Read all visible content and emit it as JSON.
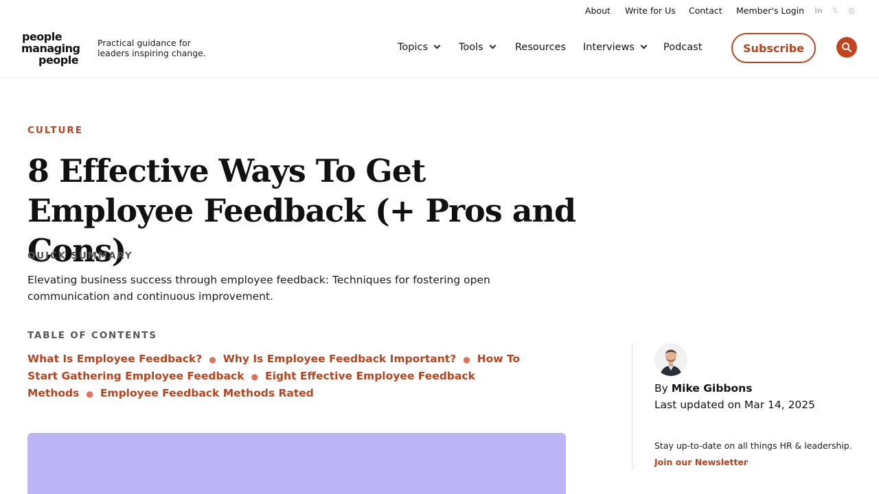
{
  "utility_nav": {
    "about": "About",
    "write_for_us": "Write for Us",
    "contact": "Contact",
    "members_login": "Member's Login"
  },
  "social": {
    "linkedin_icon": "in",
    "x_icon": "𝕏",
    "instagram_icon": "◎"
  },
  "logo": {
    "line1": "people",
    "line2": "managing",
    "line3": "people"
  },
  "tagline": "Practical guidance for leaders inspiring change.",
  "main_nav": {
    "topics": "Topics",
    "tools": "Tools",
    "resources": "Resources",
    "interviews": "Interviews",
    "podcast": "Podcast",
    "subscribe": "Subscribe"
  },
  "article": {
    "category": "CULTURE",
    "title": "8 Effective Ways To Get Employee Feedback (+ Pros and Cons)",
    "summary_label": "QUICK SUMMARY",
    "summary": "Elevating business success through employee feedback: Techniques for fostering open communication and continuous improvement.",
    "toc_label": "TABLE OF CONTENTS",
    "toc": [
      "What Is Employee Feedback?",
      "Why Is Employee Feedback Important?",
      "How To Start Gathering Employee Feedback",
      "Eight Effective Employee Feedback Methods",
      "Employee Feedback Methods Rated"
    ]
  },
  "sidebar": {
    "by_prefix": "By",
    "author": "Mike Gibbons",
    "updated": "Last updated on Mar 14, 2025",
    "newsletter_text": "Stay up-to-date on all things HR & leadership.",
    "newsletter_link": "Join our Newsletter"
  },
  "colors": {
    "accent": "#b7441f",
    "hero_bg": "#bdb4f7"
  }
}
